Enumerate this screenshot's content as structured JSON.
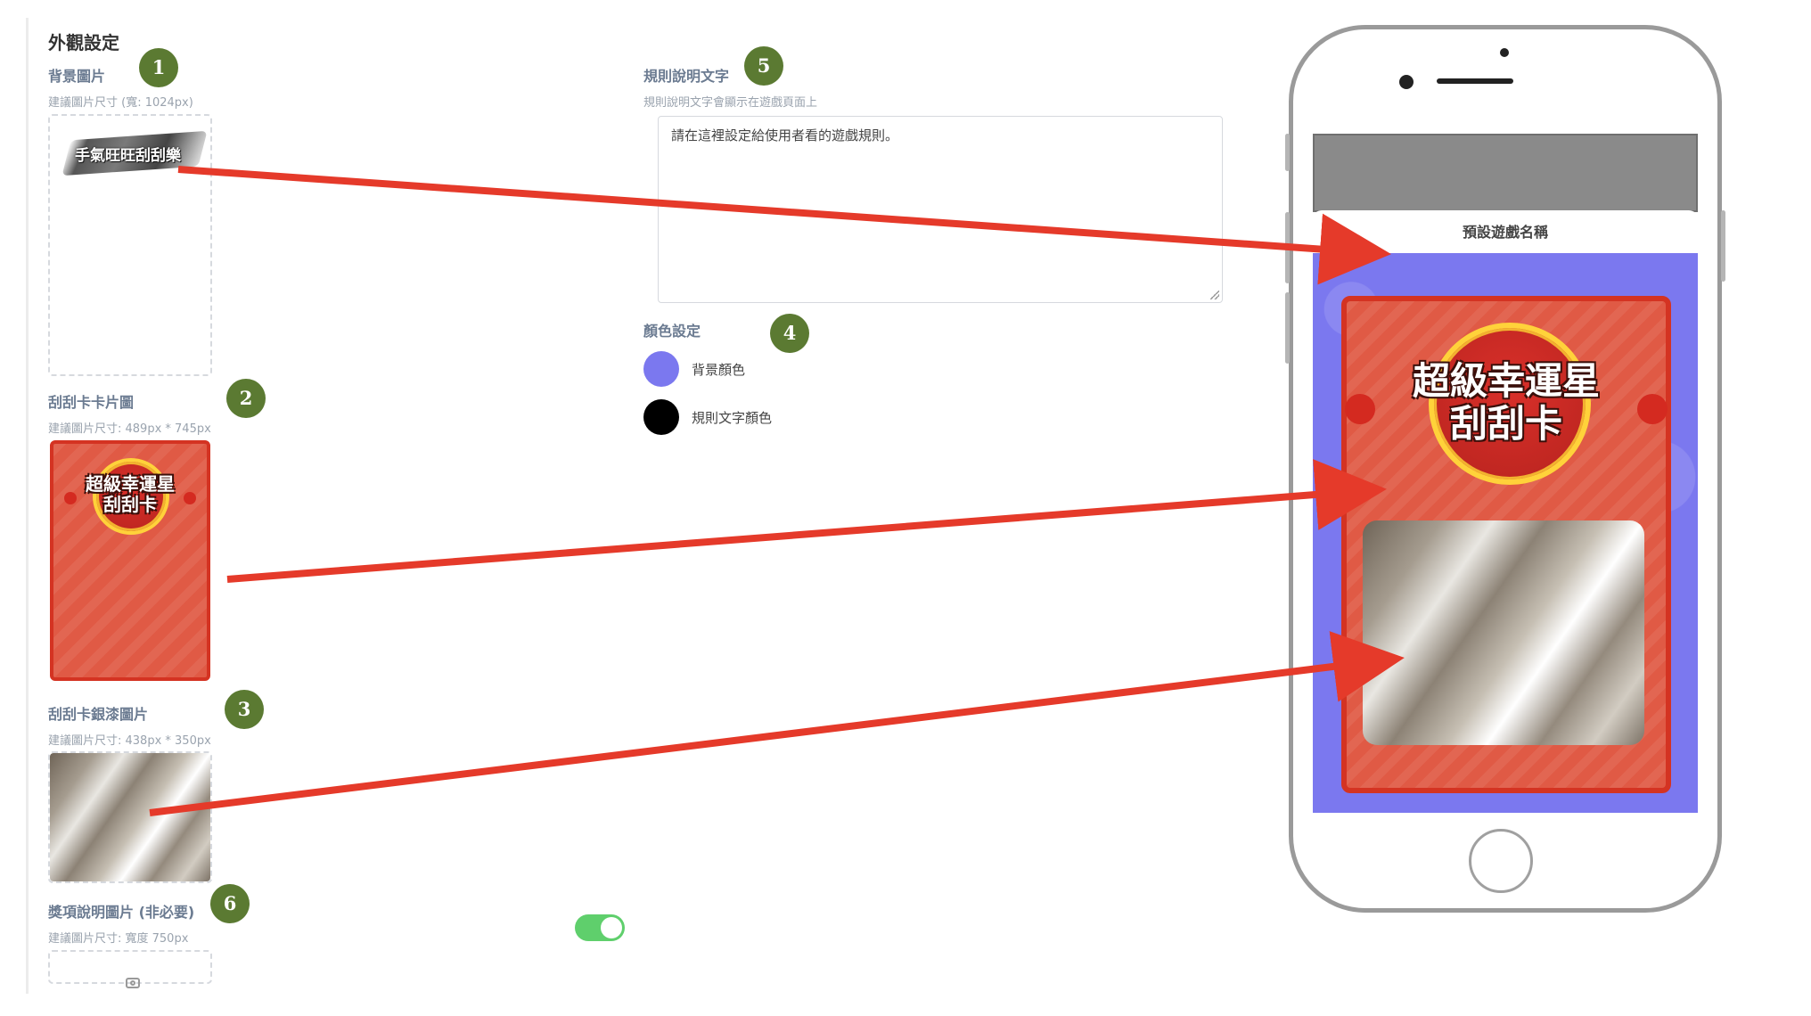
{
  "appearance": {
    "section_title": "外觀設定",
    "background_image": {
      "label": "背景圖片",
      "hint": "建議圖片尺寸 (寬: 1024px)",
      "preview_text": "手氣旺旺刮刮樂"
    },
    "card_image": {
      "label": "刮刮卡卡片圖",
      "hint": "建議圖片尺寸: 489px * 745px",
      "card_title_line1": "超級幸運星",
      "card_title_line2": "刮刮卡"
    },
    "silver_image": {
      "label": "刮刮卡銀漆圖片",
      "hint": "建議圖片尺寸: 438px * 350px"
    },
    "prize_image": {
      "label": "獎項說明圖片 (非必要)",
      "hint": "建議圖片尺寸: 寬度 750px",
      "upload_icon": "camera-icon"
    }
  },
  "rules": {
    "label": "規則說明文字",
    "hint": "規則說明文字會顯示在遊戲頁面上",
    "value": "請在這裡設定給使用者看的遊戲規則。"
  },
  "colors": {
    "label": "顏色設定",
    "items": [
      {
        "label": "背景顏色",
        "color": "#7b78ef"
      },
      {
        "label": "規則文字顏色",
        "color": "#000000"
      }
    ]
  },
  "toggle": {
    "on": true,
    "color": "#5fcf6c"
  },
  "badges": [
    "1",
    "2",
    "3",
    "4",
    "5",
    "6"
  ],
  "preview": {
    "game_name": "預設遊戲名稱",
    "card_title_line1": "超級幸運星",
    "card_title_line2": "刮刮卡"
  },
  "annotation": {
    "badge_color": "#5b7a32",
    "arrow_color": "#e53a2a"
  }
}
